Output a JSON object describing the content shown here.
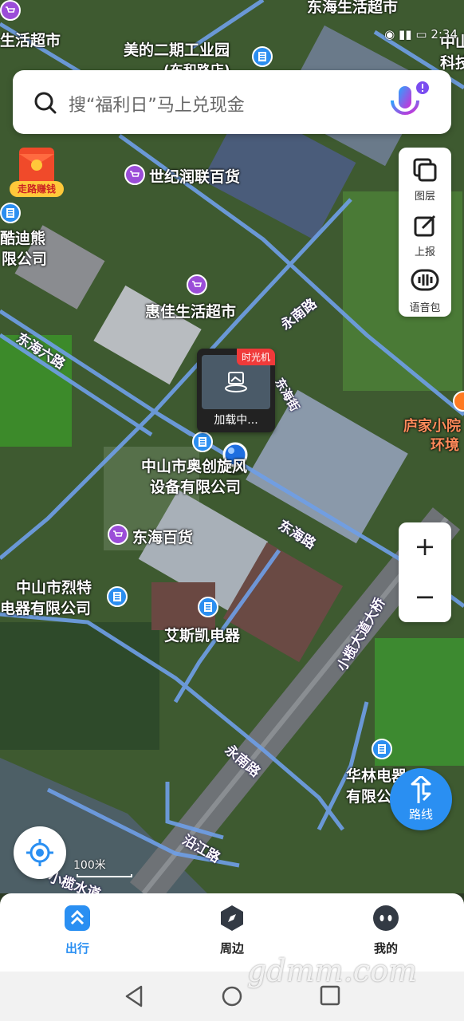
{
  "search": {
    "placeholder": "搜“福利日”马上兑现金"
  },
  "status": {
    "time": "2:34"
  },
  "pois": {
    "donghai_supermarket_top": "东海生活超市",
    "supermarket_left": "生活超市",
    "meide_park": "美的二期工业园",
    "meide_park_sub": "(东和路店)",
    "zhongshan_right": "中山",
    "tech_right": "科技",
    "shiji": "世纪润联百货",
    "kudixiong_1": "酷迪熊",
    "kudixiong_2": "限公司",
    "huijia": "惠佳生活超市",
    "luojia": "庐家小院",
    "huanjing": "环境",
    "aochuang_1": "中山市奥创旋风",
    "aochuang_2": "设备有限公司",
    "donghai_baihuo": "东海百货",
    "liete_1": "中山市烈特",
    "liete_2": "电器有限公司",
    "aisikai": "艾斯凯电器",
    "hualin_1": "华林电器",
    "hualin_2": "有限公司"
  },
  "roads": {
    "donghai_6": "东海六路",
    "yongan_1": "永南路",
    "donghai_road": "东海路",
    "xiaolan_bridge": "小榄大道大桥",
    "yongan_2": "永南路",
    "yanjiang": "沿江路",
    "xiaolan_water": "小榄水道",
    "donghai_jie": "东海街"
  },
  "map_tools": {
    "layers": "图层",
    "report": "上报",
    "voice_pack": "语音包"
  },
  "zoom": {
    "in": "+",
    "out": "−"
  },
  "route_button": {
    "label": "路线"
  },
  "scale": {
    "label": "100米"
  },
  "time_machine": {
    "badge": "时光机",
    "loading": "加载中..."
  },
  "red_packet": {
    "label": "走路赚钱"
  },
  "bottom_nav": {
    "travel": "出行",
    "nearby": "周边",
    "mine": "我的"
  },
  "watermark": "gdmm.com",
  "colors": {
    "accent": "#2a8ff2",
    "shop_pin": "#9b4dd8",
    "road": "#6f9fe8"
  }
}
